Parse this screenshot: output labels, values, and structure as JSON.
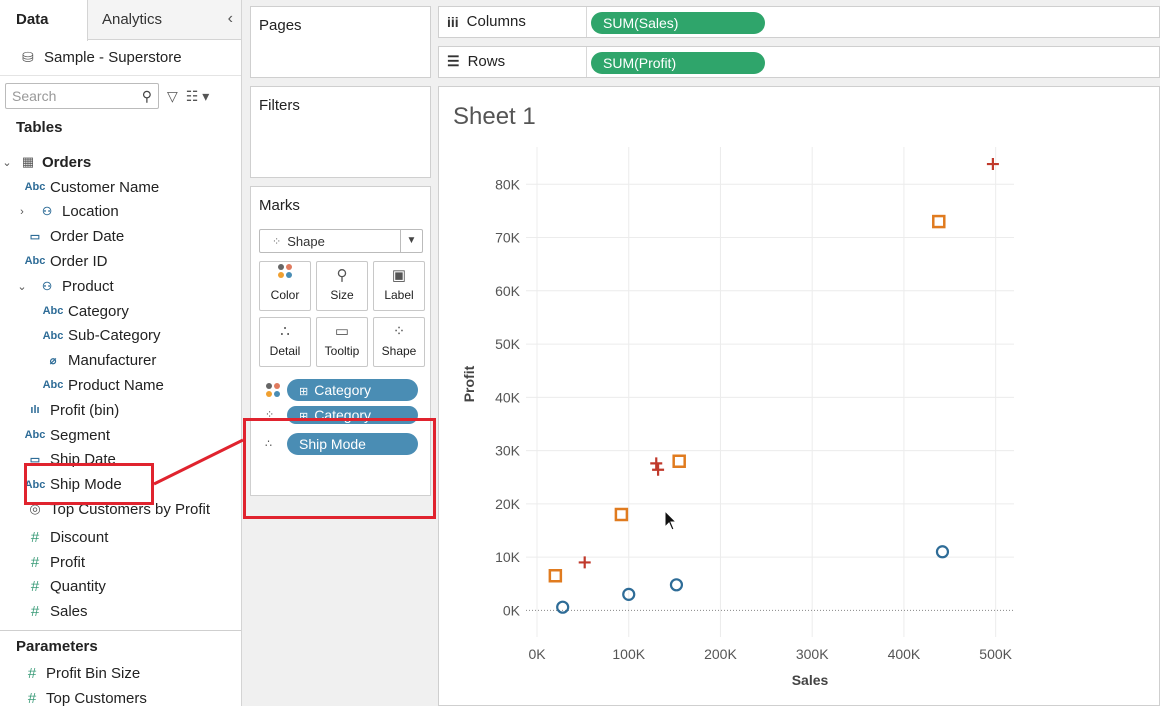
{
  "data_pane": {
    "tabs": [
      "Data",
      "Analytics"
    ],
    "collapse_icon": "chevron-left-icon",
    "datasource": "Sample - Superstore",
    "search_placeholder": "Search",
    "tables_title": "Tables",
    "orders_label": "Orders",
    "fields": [
      {
        "name": "Customer Name",
        "type": "Abc"
      },
      {
        "name": "Location",
        "type": "hierarchy"
      },
      {
        "name": "Order Date",
        "type": "date"
      },
      {
        "name": "Order ID",
        "type": "Abc"
      },
      {
        "name": "Product",
        "type": "hierarchy"
      },
      {
        "name": "Category",
        "type": "Abc"
      },
      {
        "name": "Sub-Category",
        "type": "Abc"
      },
      {
        "name": "Manufacturer",
        "type": "clip"
      },
      {
        "name": "Product Name",
        "type": "Abc"
      },
      {
        "name": "Profit (bin)",
        "type": "bin"
      },
      {
        "name": "Segment",
        "type": "Abc"
      },
      {
        "name": "Ship Date",
        "type": "date"
      },
      {
        "name": "Ship Mode",
        "type": "Abc"
      },
      {
        "name": "Top Customers by Profit",
        "type": "set"
      },
      {
        "name": "Discount",
        "type": "#"
      },
      {
        "name": "Profit",
        "type": "#"
      },
      {
        "name": "Quantity",
        "type": "#"
      },
      {
        "name": "Sales",
        "type": "#"
      }
    ],
    "parameters_title": "Parameters",
    "parameters": [
      "Profit Bin Size",
      "Top Customers"
    ]
  },
  "cards": {
    "pages": "Pages",
    "filters": "Filters",
    "marks": "Marks",
    "mark_type": "Shape",
    "mark_buttons": [
      "Color",
      "Size",
      "Label",
      "Detail",
      "Tooltip",
      "Shape"
    ],
    "mark_pills": [
      "Category",
      "Category",
      "Ship Mode"
    ]
  },
  "shelves": {
    "columns_label": "Columns",
    "columns_pill": "SUM(Sales)",
    "rows_label": "Rows",
    "rows_pill": "SUM(Profit)"
  },
  "view": {
    "sheet_title": "Sheet 1"
  },
  "colors": {
    "furniture": "#e07b1f",
    "office_supplies": "#2e6c97",
    "technology": "#c0392b",
    "pill_blue": "#4a8db4",
    "pill_green": "#2fa56b",
    "annotation": "#e0232e"
  },
  "chart_data": {
    "type": "scatter",
    "xlabel": "Sales",
    "ylabel": "Profit",
    "xlim": [
      -12000,
      520000
    ],
    "ylim": [
      -5000,
      87000
    ],
    "x_ticks": [
      0,
      100000,
      200000,
      300000,
      400000,
      500000
    ],
    "x_tick_labels": [
      "0K",
      "100K",
      "200K",
      "300K",
      "400K",
      "500K"
    ],
    "y_ticks": [
      0,
      10000,
      20000,
      30000,
      40000,
      50000,
      60000,
      70000,
      80000
    ],
    "y_tick_labels": [
      "0K",
      "10K",
      "20K",
      "30K",
      "40K",
      "50K",
      "60K",
      "70K",
      "80K"
    ],
    "grid": true,
    "series": [
      {
        "shape": "square",
        "color": "#e07b1f",
        "points": [
          [
            20000,
            6500
          ],
          [
            92000,
            18000
          ],
          [
            155000,
            28000
          ],
          [
            438000,
            73000
          ]
        ]
      },
      {
        "shape": "circle",
        "color": "#2e6c97",
        "points": [
          [
            28000,
            600
          ],
          [
            100000,
            3000
          ],
          [
            152000,
            4800
          ],
          [
            442000,
            11000
          ]
        ]
      },
      {
        "shape": "plus",
        "color": "#c0392b",
        "points": [
          [
            52000,
            9000
          ],
          [
            130000,
            27600
          ],
          [
            132000,
            26400
          ],
          [
            497000,
            83800
          ]
        ]
      }
    ]
  }
}
